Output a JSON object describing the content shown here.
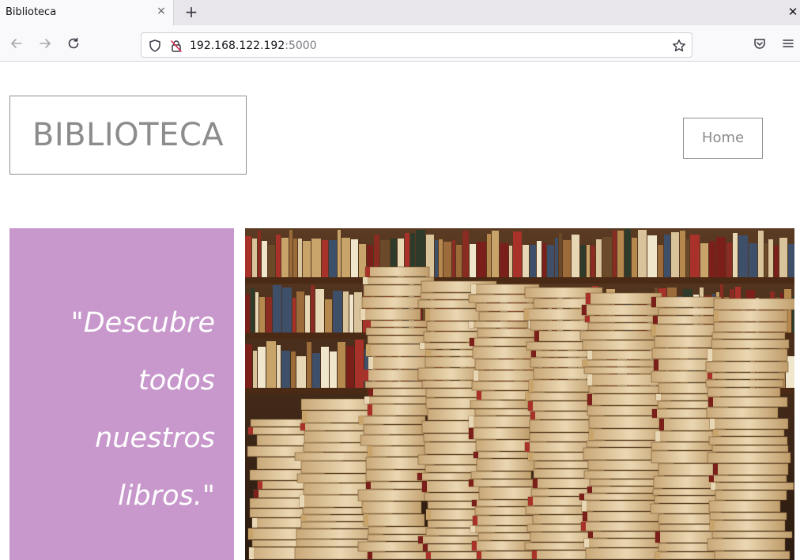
{
  "browser": {
    "tab_title": "Biblioteca",
    "tab_close_glyph": "×",
    "new_tab_glyph": "+",
    "window_close_glyph": "✕",
    "url_host": "192.168.122.192",
    "url_port": ":5000"
  },
  "header": {
    "logo": "BIBLIOTECA",
    "nav_home": "Home"
  },
  "hero": {
    "quote": "\"Descubre todos nuestros libros.\"",
    "image_alt": "library-books-photo"
  },
  "colors": {
    "quote_panel": "#c898cc",
    "text_gray": "#8c8c8c"
  }
}
